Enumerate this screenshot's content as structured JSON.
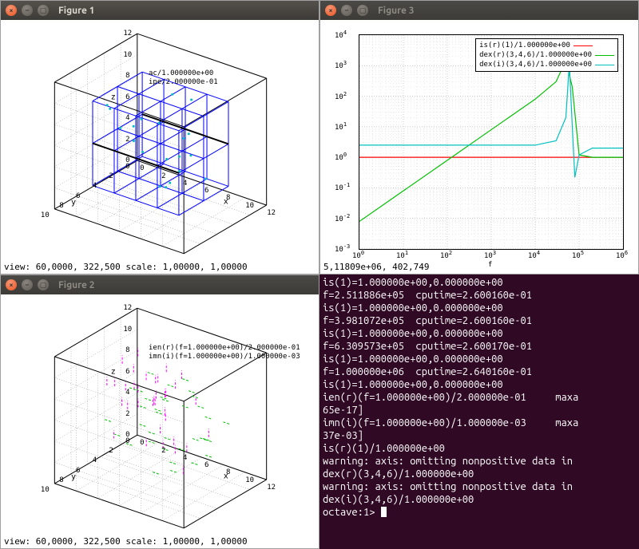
{
  "windows": {
    "fig1": {
      "title": "Figure 1",
      "status": "view: 60,0000, 322,500  scale: 1,00000, 1,00000",
      "zlabel": "z",
      "ylabel": "y",
      "xlabel": "x",
      "z_ticks": [
        "0",
        "2",
        "4",
        "6",
        "8",
        "10",
        "12"
      ],
      "y_ticks": [
        "0",
        "2",
        "4",
        "6",
        "8",
        "10"
      ],
      "x_ticks": [
        "0",
        "2",
        "4",
        "6",
        "8",
        "10",
        "12"
      ],
      "text_labels": [
        "ac/1.000000e+00",
        "ipe/2.000000e-01"
      ]
    },
    "fig2": {
      "title": "Figure 2",
      "status": "view: 60,0000, 322,500  scale: 1,00000, 1,00000",
      "zlabel": "z",
      "ylabel": "y",
      "xlabel": "x",
      "z_ticks": [
        "0",
        "2",
        "4",
        "6",
        "8",
        "10",
        "12"
      ],
      "y_ticks": [
        "0",
        "2",
        "4",
        "6",
        "8",
        "10"
      ],
      "x_ticks": [
        "0",
        "2",
        "4",
        "6",
        "8",
        "10",
        "12"
      ],
      "text_labels": [
        "ien(r)(f=1.000000e+00)/2.000000e-01",
        "imn(i)(f=1.000000e+00)/1.000000e-03"
      ]
    },
    "fig3": {
      "title": "Figure 3",
      "status": "5,11809e+06,  402,749",
      "xlabel": "f",
      "x_ticks_exp": [
        0,
        1,
        2,
        3,
        4,
        5,
        6
      ],
      "y_ticks_exp": [
        -3,
        -2,
        -1,
        0,
        1,
        2,
        3,
        4
      ],
      "legend": [
        {
          "label": "is(r)(1)/1.000000e+00",
          "color": "#ff0000"
        },
        {
          "label": "dex(r)(3,4,6)/1.000000e+00",
          "color": "#00c000"
        },
        {
          "label": "dex(i)(3,4,6)/1.000000e+00",
          "color": "#00c0c0"
        }
      ]
    }
  },
  "terminal": {
    "lines": [
      "is(1)=1.000000e+00,0.000000e+00",
      "f=2.511886e+05  cputime=2.600160e-01",
      "is(1)=1.000000e+00,0.000000e+00",
      "f=3.981072e+05  cputime=2.600160e-01",
      "is(1)=1.000000e+00,0.000000e+00",
      "f=6.309573e+05  cputime=2.600170e-01",
      "is(1)=1.000000e+00,0.000000e+00",
      "f=1.000000e+06  cputime=2.640160e-01",
      "is(1)=1.000000e+00,0.000000e+00",
      "ien(r)(f=1.000000e+00)/2.000000e-01     maxa",
      "65e-17]",
      "imn(i)(f=1.000000e+00)/1.000000e-03     maxa",
      "37e-03]",
      "is(r)(1)/1.000000e+00",
      "warning: axis: omitting nonpositive data in ",
      "dex(r)(3,4,6)/1.000000e+00",
      "warning: axis: omitting nonpositive data in ",
      "dex(i)(3,4,6)/1.000000e+00"
    ],
    "prompt": "octave:1> "
  },
  "chart_data": [
    {
      "type": "3d-wireframe",
      "title": "Figure 1",
      "xlabel": "x",
      "ylabel": "y",
      "zlabel": "z",
      "xlim": [
        0,
        12
      ],
      "ylim": [
        0,
        10
      ],
      "zlim": [
        0,
        12
      ],
      "view": {
        "azimuth": 322.5,
        "elevation": 60
      },
      "annotations": [
        "ac/1.000000e+00",
        "ipe/2.000000e-01"
      ],
      "series": [
        {
          "name": "ac",
          "color": "#0000ff",
          "box": {
            "x": [
              2,
              10
            ],
            "y": [
              2,
              8
            ],
            "z": [
              2,
              10
            ]
          }
        },
        {
          "name": "ipe",
          "color": "#00c0c0",
          "points": "scatter inside box"
        }
      ]
    },
    {
      "type": "3d-scatter",
      "title": "Figure 2",
      "xlabel": "x",
      "ylabel": "y",
      "zlabel": "z",
      "xlim": [
        0,
        12
      ],
      "ylim": [
        0,
        10
      ],
      "zlim": [
        0,
        12
      ],
      "view": {
        "azimuth": 322.5,
        "elevation": 60
      },
      "annotations": [
        "ien(r)(f=1.000000e+00)/2.000000e-01",
        "imn(i)(f=1.000000e+00)/1.000000e-03"
      ],
      "series": [
        {
          "name": "ien(r)",
          "color": "#00c000"
        },
        {
          "name": "imn(i)",
          "color": "#ff00ff"
        }
      ]
    },
    {
      "type": "line",
      "title": "Figure 3",
      "xlabel": "f",
      "ylabel": "",
      "xscale": "log",
      "yscale": "log",
      "xlim": [
        1,
        1000000.0
      ],
      "ylim": [
        0.001,
        10000.0
      ],
      "series": [
        {
          "name": "is(r)(1)/1.000000e+00",
          "color": "#ff0000",
          "x": [
            1,
            1000000.0
          ],
          "y": [
            1.0,
            1.0
          ]
        },
        {
          "name": "dex(r)(3,4,6)/1.000000e+00",
          "color": "#00c000",
          "x": [
            1,
            10,
            100,
            1000,
            10000,
            30000,
            50000,
            70000,
            100000,
            200000,
            1000000
          ],
          "y": [
            0.008,
            0.08,
            0.8,
            8,
            80,
            300,
            1500,
            200,
            1.2,
            1.0,
            1.0
          ]
        },
        {
          "name": "dex(i)(3,4,6)/1.000000e+00",
          "color": "#00c0c0",
          "x": [
            1,
            10000,
            30000,
            50000,
            60000,
            70000,
            80000,
            100000,
            200000,
            1000000
          ],
          "y": [
            2.5,
            2.5,
            3.5,
            20,
            1200,
            10,
            0.22,
            1.2,
            2.0,
            2.0
          ]
        }
      ]
    }
  ]
}
